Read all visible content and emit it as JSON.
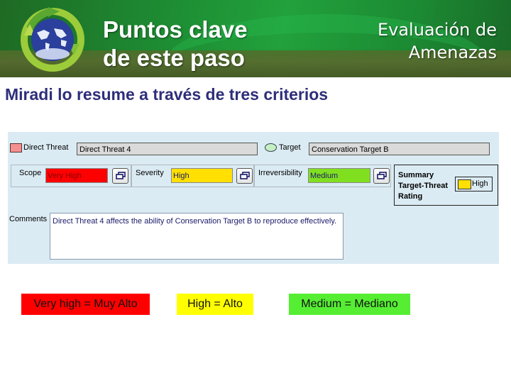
{
  "header": {
    "title_line1": "Puntos clave",
    "title_line2": "de este paso",
    "section_line1": "Evaluación de",
    "section_line2": "Amenazas",
    "logo_icon": "recycling-globe-icon"
  },
  "subtitle": "Miradi lo resume a través de tres criterios",
  "panel": {
    "direct_threat": {
      "label": "Direct Threat",
      "value": "Direct Threat 4",
      "swatch_color": "#f59090"
    },
    "target": {
      "label": "Target",
      "value": "Conservation Target B",
      "swatch_color": "#c6f0c2"
    },
    "criteria": [
      {
        "label": "Scope",
        "value": "Very High",
        "color": "#ff0000",
        "text_color": "#8a0000"
      },
      {
        "label": "Severity",
        "value": "High",
        "color": "#ffe000",
        "text_color": "#1a1a6a"
      },
      {
        "label": "Irreversibility",
        "value": "Medium",
        "color": "#80e020",
        "text_color": "#1a1a6a"
      }
    ],
    "popup_button_icon": "window-restore-icon",
    "summary": {
      "label_line1": "Summary",
      "label_line2": "Target-Threat",
      "label_line3": "Rating",
      "value": "High",
      "color": "#ffe000"
    },
    "comments": {
      "label": "Comments",
      "value": "Direct Threat 4 affects the ability of Conservation Target B to reproduce effectively."
    }
  },
  "legend": [
    {
      "text": "Very high = Muy Alto",
      "color": "#ff0000"
    },
    {
      "text": "High = Alto",
      "color": "#ffff00"
    },
    {
      "text": "Medium = Mediano",
      "color": "#55ee33"
    }
  ]
}
